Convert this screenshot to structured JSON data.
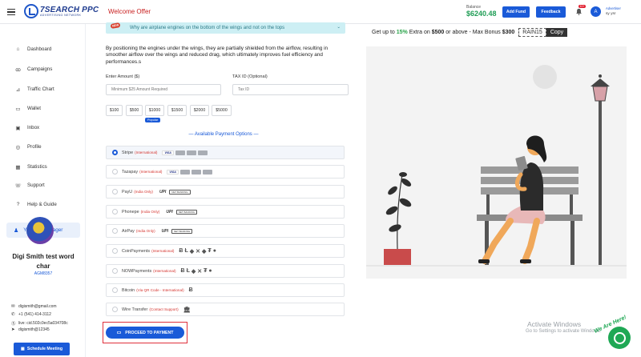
{
  "header": {
    "logo_line1": "7SEARCH PPC",
    "logo_line2": "ADVERTISING NETWORK",
    "welcome": "Welcome Offer",
    "balance_label": "Balance",
    "balance_value": "$6240.48",
    "add_fund": "Add Fund",
    "feedback": "Feedback",
    "notif_count": "10+",
    "avatar_letter": "A",
    "user_role": "Advertiser",
    "user_name": "sy ysr"
  },
  "sidebar": {
    "items": [
      {
        "label": "Dashboard",
        "icon": "home-icon"
      },
      {
        "label": "Campaigns",
        "icon": "campaign-icon"
      },
      {
        "label": "Traffic Chart",
        "icon": "chart-icon"
      },
      {
        "label": "Wallet",
        "icon": "wallet-icon"
      },
      {
        "label": "Inbox",
        "icon": "inbox-icon"
      },
      {
        "label": "Profile",
        "icon": "profile-icon"
      },
      {
        "label": "Statistics",
        "icon": "statistics-icon"
      },
      {
        "label": "Support",
        "icon": "support-icon"
      },
      {
        "label": "Help & Guide",
        "icon": "help-icon"
      }
    ],
    "ad_manager": "Your Ad Manager",
    "profile_name": "Digi Smith test word char",
    "profile_id": "AGM8357",
    "email": "digismith@gmail.com",
    "phone": "+1 (541) 414-3112",
    "skype": "live: cid.502c0ec5a034708c",
    "telegram": "digismith@12345",
    "schedule": "Schedule Meeting"
  },
  "main": {
    "new_badge": "NEW",
    "tip": "Why are airplane engines on the bottom of the wings and not on the tops",
    "description": "By positioning the engines under the wings, they are partially shielded from the airflow, resulting in smoother airflow over the wings and reduced drag, which ultimately improves fuel efficiency and performances.s",
    "amount_label": "Enter Amount ($)",
    "amount_placeholder": "Minimum $25 Amount Required",
    "tax_label": "TAX ID (Optional)",
    "tax_placeholder": "Tax ID",
    "amounts": [
      "$100",
      "$500",
      "$1000",
      "$1500",
      "$2000",
      "$5000"
    ],
    "popular": "Popular",
    "available": "— Available Payment Options —",
    "payment_methods": [
      {
        "name": "Stripe",
        "note": "(International)",
        "selected": true
      },
      {
        "name": "Tazapay",
        "note": "(International)",
        "selected": false
      },
      {
        "name": "PayU",
        "note": "(India Only)",
        "selected": false
      },
      {
        "name": "Phonepe",
        "note": "(India Only)",
        "selected": false
      },
      {
        "name": "AirPay",
        "note": "(India Only)",
        "selected": false
      },
      {
        "name": "CoinPayments",
        "note": "(International)",
        "selected": false
      },
      {
        "name": "NOWPayments",
        "note": "(International)",
        "selected": false
      },
      {
        "name": "Bitcoin",
        "note": "(Via QR Code - International)",
        "selected": false
      },
      {
        "name": "Wire Transfer",
        "note": "(Contact Support)",
        "selected": false
      }
    ],
    "badges": {
      "visa": "VISA",
      "upi": "UPI",
      "netbanking": "NET BANKING"
    },
    "proceed": "PROCEED TO PAYMENT"
  },
  "promo": {
    "prefix": "Get up to",
    "percent": "15%",
    "mid": "Extra on",
    "amount": "$500",
    "suffix": "or above - Max Bonus",
    "max": "$300",
    "code": "RAIN15",
    "copy": "Copy"
  },
  "watermark": {
    "line1": "Activate Windows",
    "line2": "Go to Settings to activate Windows."
  },
  "chat": {
    "label": "We Are Here!"
  },
  "colors": {
    "primary": "#1a5ad8",
    "balance": "#1f9d55",
    "welcome": "#c81e1e",
    "note": "#d5342f"
  }
}
